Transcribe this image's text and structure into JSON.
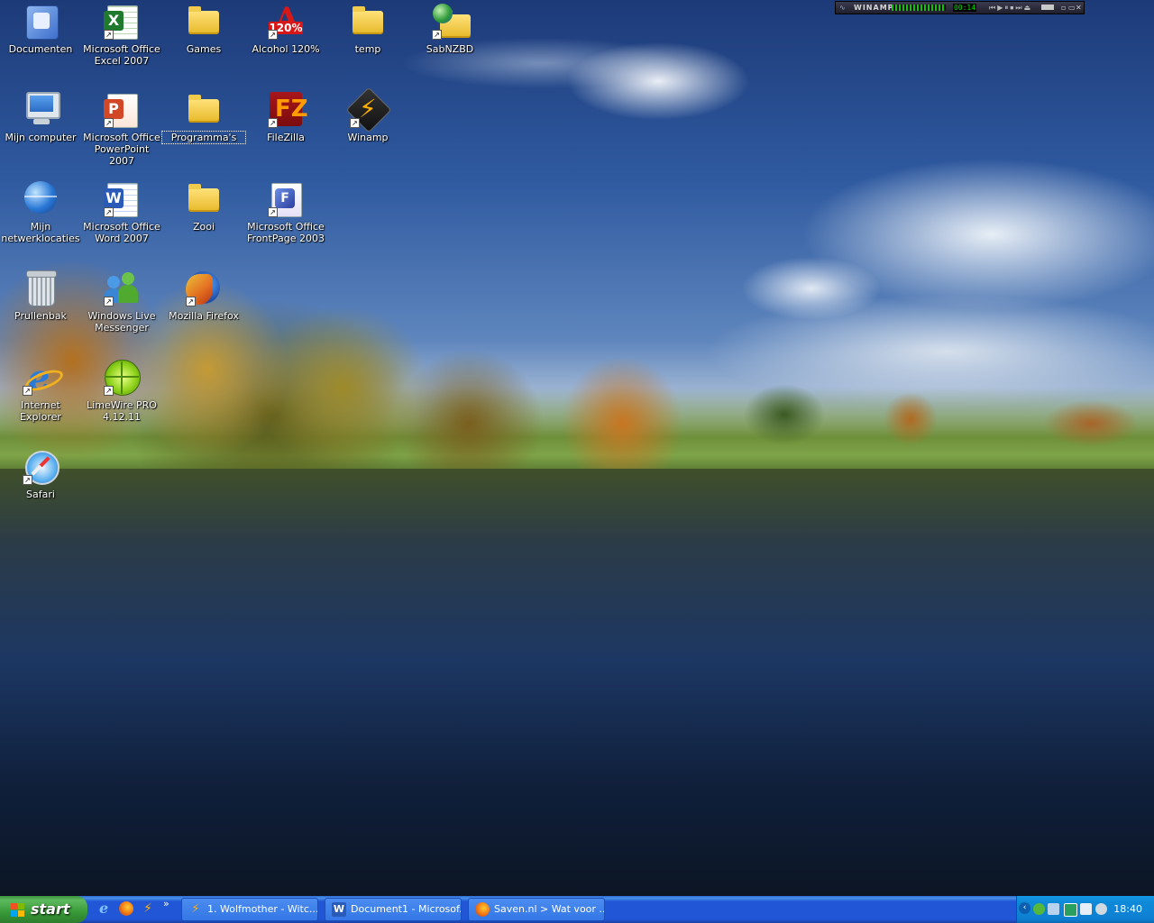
{
  "desktop": {
    "icons": [
      {
        "label": "Documenten"
      },
      {
        "label": "Microsoft Office Excel 2007"
      },
      {
        "label": "Games"
      },
      {
        "label": "Alcohol 120%"
      },
      {
        "label": "temp"
      },
      {
        "label": "SabNZBD"
      },
      {
        "label": "Mijn computer"
      },
      {
        "label": "Microsoft Office PowerPoint 2007"
      },
      {
        "label": "Programma's"
      },
      {
        "label": "FileZilla"
      },
      {
        "label": "Winamp"
      },
      {
        "label": "Mijn netwerklocaties"
      },
      {
        "label": "Microsoft Office Word 2007"
      },
      {
        "label": "Zooi"
      },
      {
        "label": "Microsoft Office FrontPage 2003"
      },
      {
        "label": "Prullenbak"
      },
      {
        "label": "Windows Live Messenger"
      },
      {
        "label": "Mozilla Firefox"
      },
      {
        "label": "Internet Explorer"
      },
      {
        "label": "LimeWire PRO 4.12.11"
      },
      {
        "label": "Safari"
      }
    ],
    "selected_icon": "Programma's"
  },
  "winamp": {
    "title": "WINAMP",
    "time": "00:14"
  },
  "taskbar": {
    "start_label": "start",
    "quick_launch": [
      "internet-explorer-icon",
      "firefox-icon",
      "winamp-icon"
    ],
    "more": "»",
    "tasks": [
      {
        "label": "1. Wolfmother - Witc...",
        "icon": "winamp-icon"
      },
      {
        "label": "Document1 - Microsof...",
        "icon": "word-icon"
      },
      {
        "label": "Saven.nl > Wat voor ...",
        "icon": "firefox-icon"
      }
    ],
    "tray": {
      "clock": "18:40"
    }
  },
  "colors": {
    "taskbar_blue": "#2157d7",
    "start_green": "#379a37",
    "tray_blue": "#0e8ad9"
  }
}
